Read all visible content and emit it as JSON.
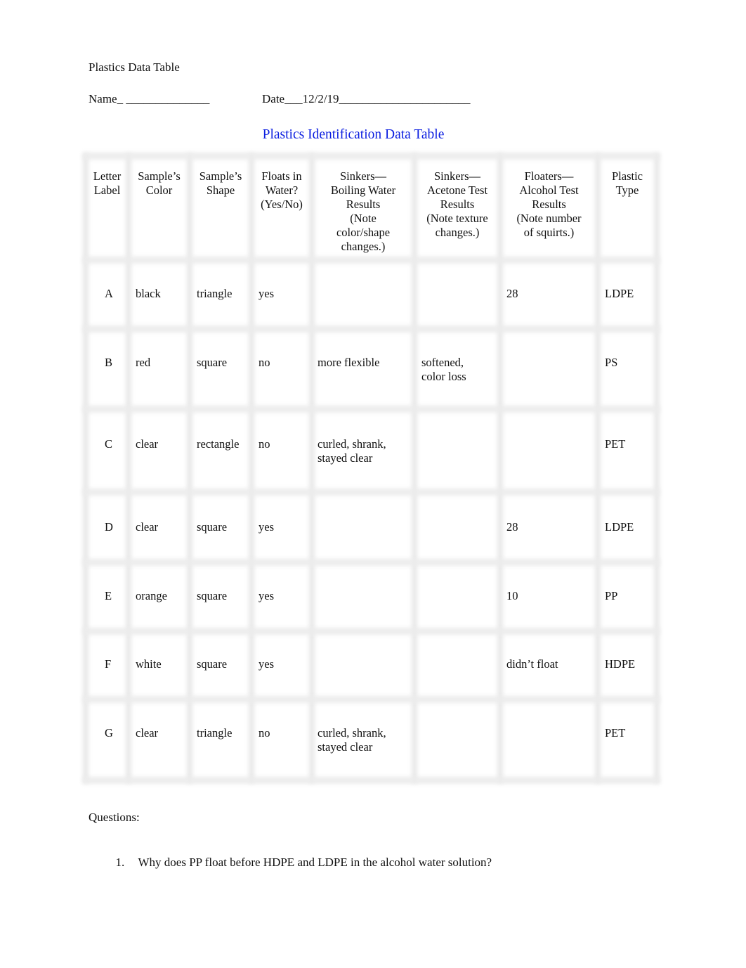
{
  "document": {
    "title": "Plastics Data Table",
    "name_label": "Name_ ______________",
    "date_label": "Date___12/2/19______________________",
    "table_title": "Plastics Identification Data Table"
  },
  "table": {
    "headers": [
      "Letter\nLabel",
      "Sample’s\nColor",
      "Sample’s\nShape",
      "Floats in\nWater?\n(Yes/No)",
      "Sinkers—\nBoiling Water\nResults\n (Note\ncolor/shape\nchanges.)",
      "Sinkers—\nAcetone Test\nResults\n(Note texture\nchanges.)",
      "Floaters—\nAlcohol Test\nResults\n(Note number\nof squirts.)",
      "Plastic\nType"
    ],
    "rows": [
      {
        "letter": "A",
        "color": "black",
        "shape": "triangle",
        "floats": "yes",
        "boiling": "",
        "acetone": "",
        "alcohol": "28",
        "type": "LDPE"
      },
      {
        "letter": "B",
        "color": "red",
        "shape": "square",
        "floats": "no",
        "boiling": "more flexible",
        "acetone": "softened,\ncolor loss",
        "alcohol": "",
        "type": "PS"
      },
      {
        "letter": "C",
        "color": "clear",
        "shape": "rectangle",
        "floats": "no",
        "boiling": "curled, shrank,\nstayed clear",
        "acetone": "",
        "alcohol": "",
        "type": "PET"
      },
      {
        "letter": "D",
        "color": "clear",
        "shape": "square",
        "floats": "yes",
        "boiling": "",
        "acetone": "",
        "alcohol": "28",
        "type": "LDPE"
      },
      {
        "letter": "E",
        "color": "orange",
        "shape": "square",
        "floats": "yes",
        "boiling": "",
        "acetone": "",
        "alcohol": "10",
        "type": "PP"
      },
      {
        "letter": "F",
        "color": "white",
        "shape": "square",
        "floats": "yes",
        "boiling": "",
        "acetone": "",
        "alcohol": "didn’t float",
        "type": "HDPE"
      },
      {
        "letter": "G",
        "color": "clear",
        "shape": "triangle",
        "floats": "no",
        "boiling": "curled, shrank,\nstayed clear",
        "acetone": "",
        "alcohol": "",
        "type": "PET"
      }
    ]
  },
  "questions": {
    "label": "Questions:",
    "items": [
      {
        "number": "1.",
        "text": "Why does PP float before HDPE and LDPE in the alcohol water solution?"
      }
    ]
  }
}
